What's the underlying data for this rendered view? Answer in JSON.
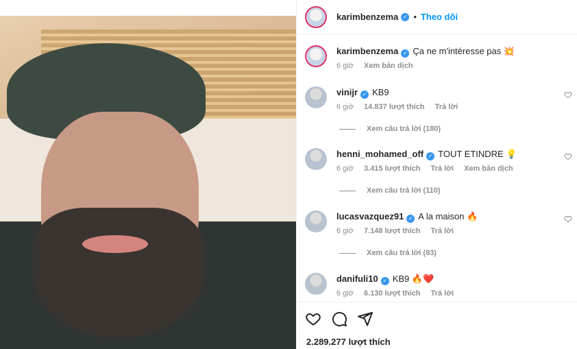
{
  "post": {
    "author": "karimbenzema",
    "follow_label": "Theo dõi",
    "dot": "•",
    "caption": {
      "username": "karimbenzema",
      "text": "Ça ne m'intéresse pas 💥",
      "time": "6 giờ",
      "translate": "Xem bản dịch"
    },
    "likes": "2.289.277 lượt thích"
  },
  "comments": [
    {
      "username": "vinijr",
      "text": "KB9",
      "time": "6 giờ",
      "likes": "14.837 lượt thích",
      "reply": "Trả lời",
      "view_replies": "Xem câu trả lời (180)"
    },
    {
      "username": "henni_mohamed_off",
      "text": "TOUT ETINDRE 💡",
      "time": "6 giờ",
      "likes": "3.415 lượt thích",
      "reply": "Trả lời",
      "translate": "Xem bản dịch",
      "view_replies": "Xem câu trả lời (110)"
    },
    {
      "username": "lucasvazquez91",
      "text": "A la maison 🔥",
      "time": "6 giờ",
      "likes": "7.148 lượt thích",
      "reply": "Trả lời",
      "view_replies": "Xem câu trả lời (83)"
    },
    {
      "username": "danifuli10",
      "text": "KB9 🔥❤️",
      "time": "6 giờ",
      "likes": "6.130 lượt thích",
      "reply": "Trả lời"
    }
  ],
  "colors": {
    "accent": "#0095f6",
    "verified": "#3897f0",
    "text": "#262626",
    "muted": "#8e8e8e"
  },
  "icons": [
    "verified-badge-icon",
    "heart-icon",
    "comment-icon",
    "share-icon"
  ]
}
